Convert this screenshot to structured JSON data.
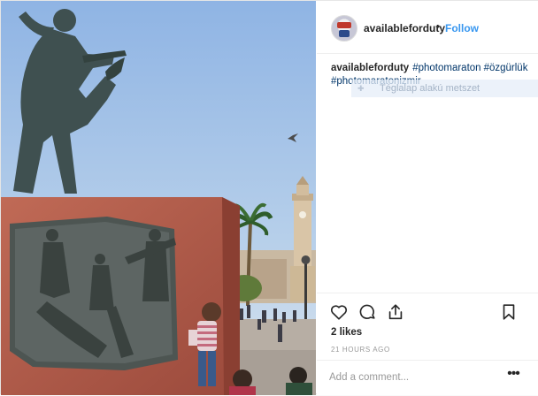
{
  "post": {
    "username": "availableforduty",
    "follow_label": "Follow",
    "separator": "•",
    "caption": {
      "username": "availableforduty",
      "hashtags": [
        "#photomaraton",
        "#özgürlük",
        "#photomaratonizmir"
      ]
    },
    "overlay_tooltip": "Téglalap alakú metszet",
    "likes": "2 likes",
    "time_ago": "21 HOURS AGO",
    "comment_placeholder": "Add a comment...",
    "more_label": "•••"
  },
  "icons": {
    "like": "heart-icon",
    "comment": "comment-icon",
    "share": "share-icon",
    "save": "bookmark-icon",
    "more": "more-options-icon"
  },
  "colors": {
    "follow_blue": "#3897f0",
    "hashtag_blue": "#003569",
    "text": "#262626",
    "muted": "#999999",
    "border": "#efefef"
  }
}
